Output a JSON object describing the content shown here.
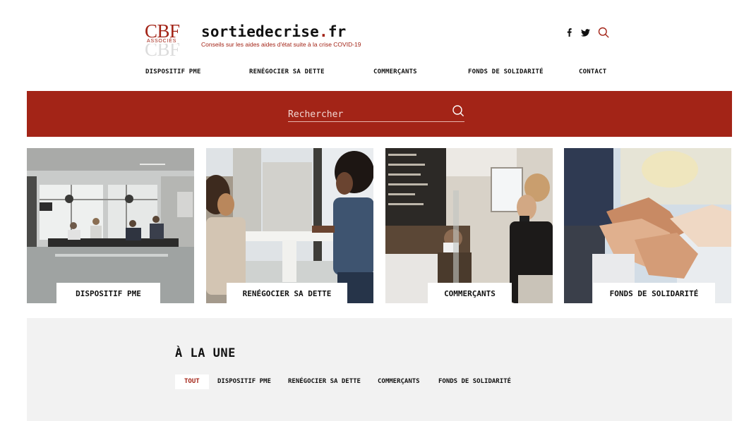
{
  "brand": {
    "logo_text": "CBF",
    "logo_subtext": "ASSOCIÉS",
    "site_name_main": "sortiedecrise",
    "site_name_dot": ".",
    "site_name_tld": "fr",
    "tagline": "Conseils sur les aides aides d'état suite à la crise COVID-19",
    "accent_color": "#a32417"
  },
  "header_icons": [
    "facebook-icon",
    "twitter-icon",
    "search-icon"
  ],
  "nav": {
    "items": [
      {
        "label": "DISPOSITIF PME"
      },
      {
        "label": "RENÉGOCIER SA DETTE"
      },
      {
        "label": "COMMERÇANTS"
      },
      {
        "label": "FONDS DE SOLIDARITÉ"
      },
      {
        "label": "CONTACT"
      }
    ]
  },
  "search": {
    "placeholder": "Rechercher",
    "value": ""
  },
  "cards": [
    {
      "label": "DISPOSITIF PME",
      "image": "meeting-room-photo"
    },
    {
      "label": "RENÉGOCIER SA DETTE",
      "image": "two-women-talking-photo"
    },
    {
      "label": "COMMERÇANTS",
      "image": "coffee-shop-counter-photo"
    },
    {
      "label": "FONDS DE SOLIDARITÉ",
      "image": "stacked-hands-photo"
    }
  ],
  "une": {
    "title": "À LA UNE",
    "filters": [
      {
        "label": "TOUT",
        "active": true
      },
      {
        "label": "DISPOSITIF PME",
        "active": false
      },
      {
        "label": "RENÉGOCIER SA DETTE",
        "active": false
      },
      {
        "label": "COMMERÇANTS",
        "active": false
      },
      {
        "label": "FONDS DE SOLIDARITÉ",
        "active": false
      }
    ]
  }
}
